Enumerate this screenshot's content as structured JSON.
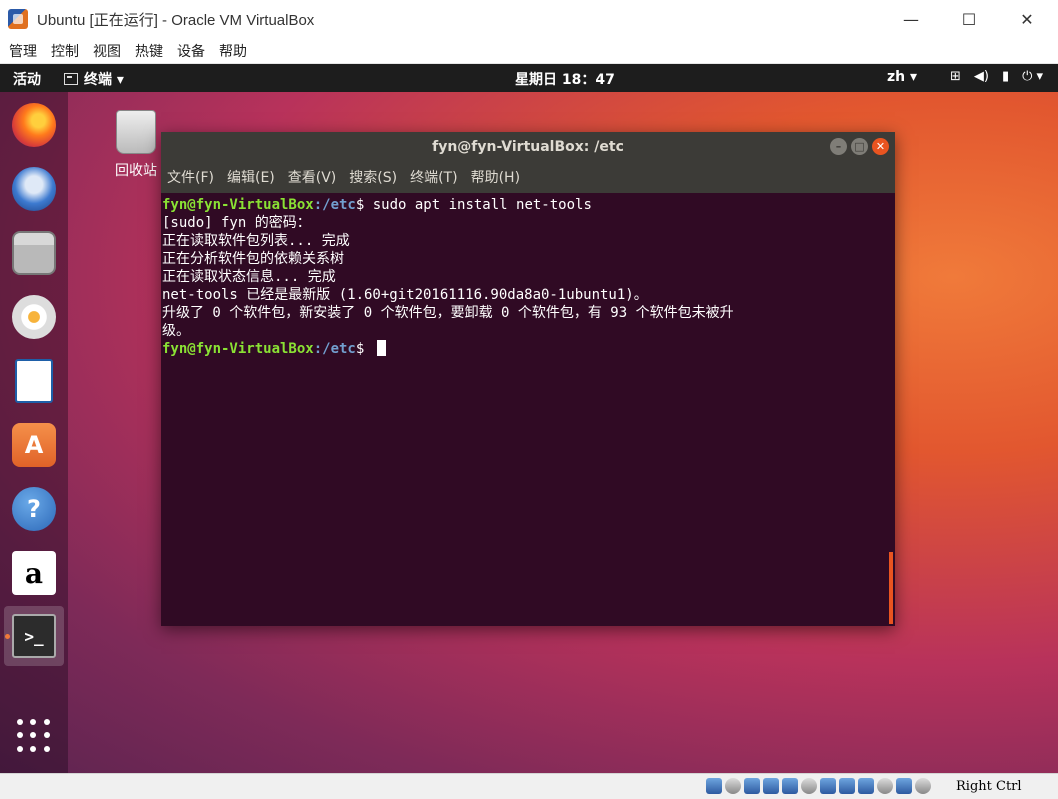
{
  "host": {
    "title": "Ubuntu [正在运行] - Oracle VM VirtualBox",
    "controls": {
      "minimize": "—",
      "maximize": "☐",
      "close": "✕"
    },
    "menu": [
      "管理",
      "控制",
      "视图",
      "热键",
      "设备",
      "帮助"
    ],
    "host_key": "Right Ctrl"
  },
  "ubuntu": {
    "topbar": {
      "activities": "活动",
      "app": "终端 ▾",
      "clock": "星期日 18：47",
      "lang": "zh ▾",
      "sys_icons": [
        "network-icon",
        "volume-icon",
        "battery-icon",
        "power-icon"
      ],
      "sys_glyphs": [
        "⊞",
        "◀)",
        "▮",
        "⏻ ▾"
      ]
    },
    "dock": [
      {
        "name": "firefox-icon",
        "label": ""
      },
      {
        "name": "thunderbird-icon",
        "label": ""
      },
      {
        "name": "files-icon",
        "label": ""
      },
      {
        "name": "rhythmbox-icon",
        "label": ""
      },
      {
        "name": "writer-icon",
        "label": ""
      },
      {
        "name": "software-store-icon",
        "label": "A"
      },
      {
        "name": "help-icon",
        "label": "?"
      },
      {
        "name": "amazon-icon",
        "label": "a"
      },
      {
        "name": "terminal-icon",
        "label": ">_"
      }
    ],
    "desktop": {
      "trash_label": "回收站"
    }
  },
  "terminal": {
    "title": "fyn@fyn-VirtualBox: /etc",
    "menu": [
      "文件(F)",
      "编辑(E)",
      "查看(V)",
      "搜索(S)",
      "终端(T)",
      "帮助(H)"
    ],
    "prompt_user": "fyn@fyn-VirtualBox",
    "prompt_path": ":/etc",
    "prompt_symbol": "$ ",
    "command": "sudo apt install net-tools",
    "output": [
      "[sudo] fyn 的密码：",
      "正在读取软件包列表... 完成",
      "正在分析软件包的依赖关系树",
      "正在读取状态信息... 完成",
      "net-tools 已经是最新版 (1.60+git20161116.90da8a0-1ubuntu1)。",
      "升级了 0 个软件包，新安装了 0 个软件包，要卸载 0 个软件包，有 93 个软件包未被升",
      "级。"
    ]
  }
}
